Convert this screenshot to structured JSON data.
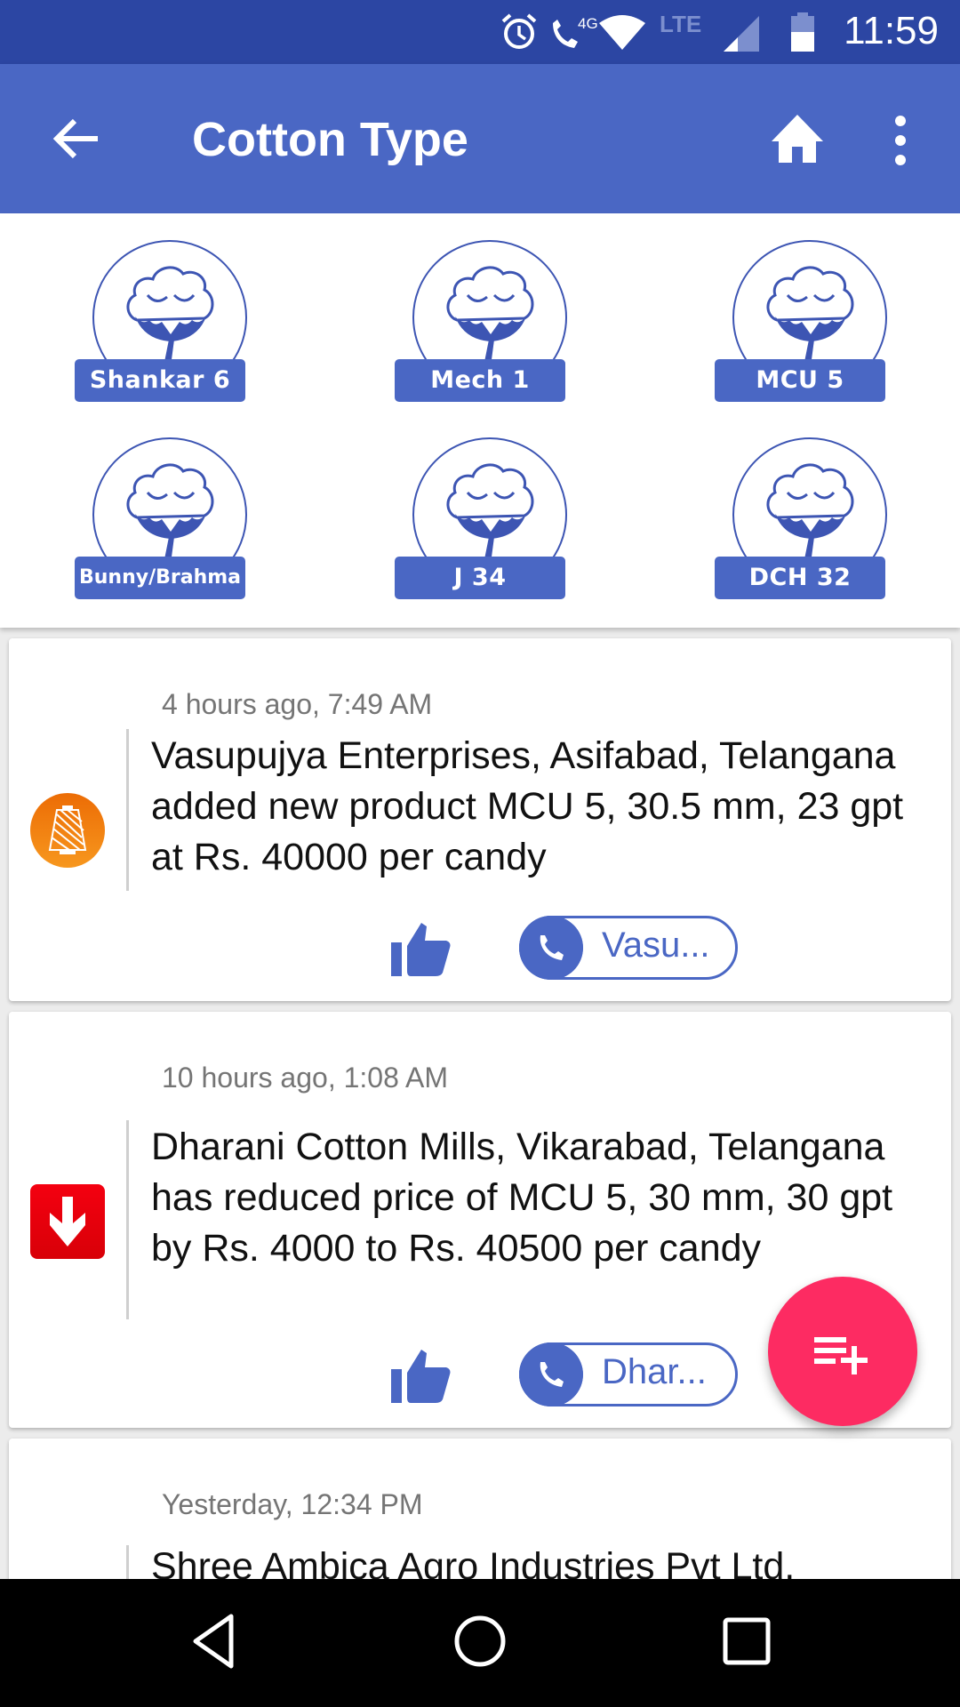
{
  "status_bar": {
    "time": "11:59",
    "network_label": "4G",
    "lte_label": "LTE",
    "icons": [
      "alarm-icon",
      "volte-call-icon",
      "wifi-icon",
      "lte-icon",
      "signal-icon",
      "battery-icon"
    ]
  },
  "app_bar": {
    "title": "Cotton Type",
    "back_icon": "arrow-back-icon",
    "home_icon": "home-icon",
    "more_icon": "more-vert-icon"
  },
  "cotton_types": [
    {
      "label": "Shankar 6"
    },
    {
      "label": "Mech 1"
    },
    {
      "label": "MCU 5"
    },
    {
      "label": "Bunny/Brahma"
    },
    {
      "label": "J 34"
    },
    {
      "label": "DCH 32"
    }
  ],
  "feed": [
    {
      "time": "4 hours ago, 7:49 AM",
      "icon": "yarn-cone-icon",
      "message": "Vasupujya Enterprises, Asifabad, Telangana added new product MCU 5, 30.5 mm, 23 gpt at Rs. 40000 per candy",
      "call_label": "Vasu...",
      "colors": {
        "icon_bg": "#f07a10"
      }
    },
    {
      "time": "10 hours ago, 1:08 AM",
      "icon": "price-down-icon",
      "message": "Dharani Cotton Mills, Vikarabad, Telangana has reduced price of MCU 5, 30 mm, 30 gpt by Rs. 4000 to Rs. 40500 per candy",
      "call_label": "Dhar...",
      "colors": {
        "icon_bg": "#e8000b"
      }
    },
    {
      "time": "Yesterday, 12:34 PM",
      "message": "Shree Ambica Agro Industries Pvt Ltd,"
    }
  ],
  "fab": {
    "icon": "playlist-add-icon"
  },
  "colors": {
    "primary": "#4a67c4",
    "primary_dark": "#2c46a3",
    "accent": "#fd2b62"
  },
  "nav_bar": {
    "icons": [
      "nav-back-icon",
      "nav-home-icon",
      "nav-recents-icon"
    ]
  }
}
